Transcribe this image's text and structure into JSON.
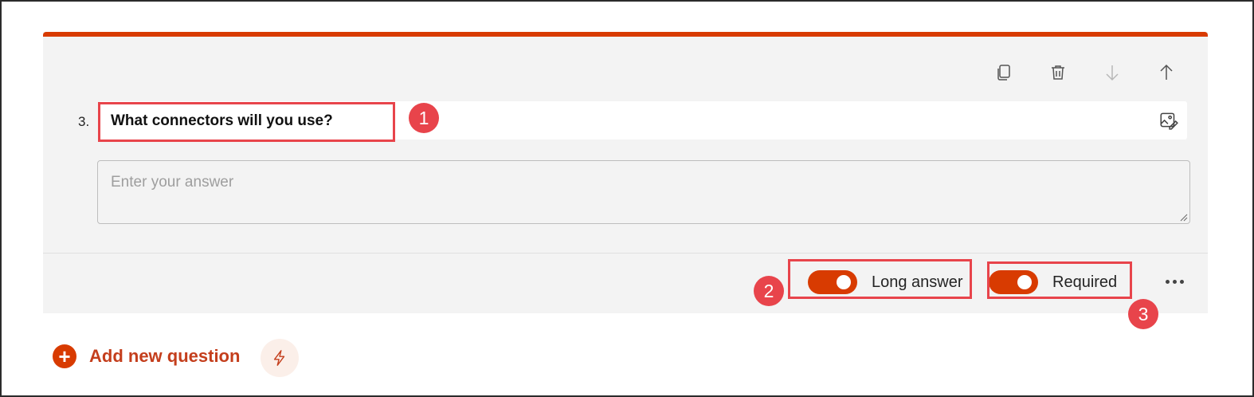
{
  "question": {
    "number": "3.",
    "title": "What connectors will you use?",
    "answer_placeholder": "Enter your answer"
  },
  "toolbar": {
    "copy_icon": "copy-icon",
    "delete_icon": "trash-icon",
    "move_down_icon": "arrow-down-icon",
    "move_up_icon": "arrow-up-icon"
  },
  "options": {
    "long_answer_label": "Long answer",
    "long_answer_on": true,
    "required_label": "Required",
    "required_on": true
  },
  "add_question": {
    "label": "Add new question"
  },
  "callouts": [
    "1",
    "2",
    "3"
  ],
  "colors": {
    "accent": "#d83b01",
    "callout": "#e8444b",
    "card_bg": "#f3f3f3"
  }
}
